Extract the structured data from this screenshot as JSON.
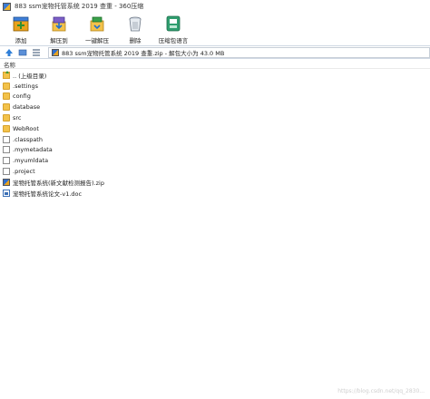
{
  "window": {
    "title": "883 ssm宠物托管系统  2019 查重 - 360压缩"
  },
  "toolbar": {
    "items": [
      {
        "label": "添加",
        "icon": "add-archive-icon"
      },
      {
        "label": "解压到",
        "icon": "extract-to-icon"
      },
      {
        "label": "一键解压",
        "icon": "one-click-extract-icon"
      },
      {
        "label": "删除",
        "icon": "delete-icon"
      },
      {
        "label": "压缩包语言",
        "icon": "archive-language-icon"
      }
    ]
  },
  "address": {
    "path": "883 ssm宠物托管系统  2019 查重.zip - 解包大小为 43.0 MB"
  },
  "list": {
    "column_name": "名称",
    "rows": [
      {
        "name": ".. (上级目录)",
        "type": "up"
      },
      {
        "name": ".settings",
        "type": "folder"
      },
      {
        "name": "config",
        "type": "folder"
      },
      {
        "name": "database",
        "type": "folder"
      },
      {
        "name": "src",
        "type": "folder"
      },
      {
        "name": "WebRoot",
        "type": "folder"
      },
      {
        "name": ".classpath",
        "type": "file"
      },
      {
        "name": ".mymetadata",
        "type": "file"
      },
      {
        "name": ".myumldata",
        "type": "file"
      },
      {
        "name": ".project",
        "type": "file"
      },
      {
        "name": "宠物托管系统(新文献检测报告).zip",
        "type": "zip"
      },
      {
        "name": "宠物托管系统论文-v1.doc",
        "type": "doc"
      }
    ]
  },
  "watermark": "https://blog.csdn.net/qq_2830..."
}
